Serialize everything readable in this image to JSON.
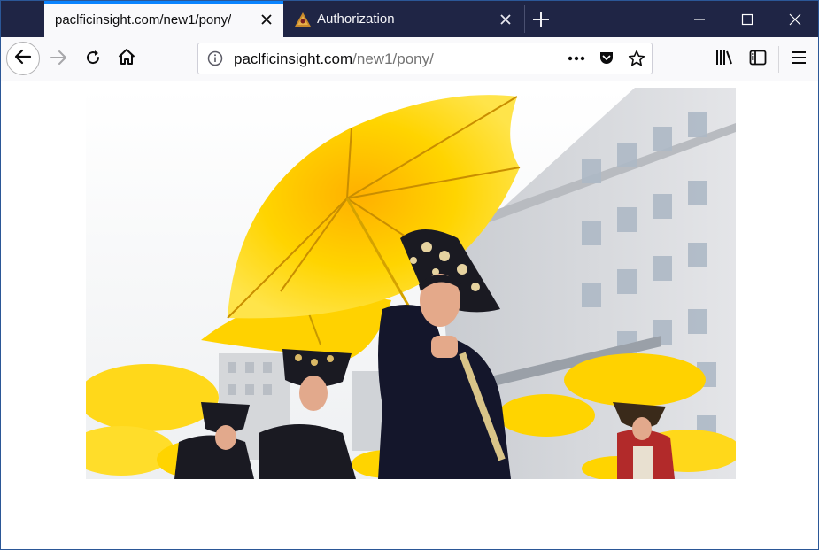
{
  "tabs": [
    {
      "label": "paclficinsight.com/new1/pony/",
      "active": true
    },
    {
      "label": "Authorization",
      "active": false,
      "favicon": "shield-warning-icon"
    }
  ],
  "address_bar": {
    "host": "paclficinsight.com",
    "path": "/new1/pony/"
  },
  "icons": {
    "back": "arrow-left-icon",
    "forward": "arrow-right-icon",
    "reload": "reload-icon",
    "home": "home-icon",
    "site_info": "info-icon",
    "page_actions": "more-horizontal-icon",
    "pocket": "pocket-icon",
    "bookmark": "star-icon",
    "library": "library-icon",
    "sidebar": "sidebar-icon",
    "menu": "hamburger-menu-icon"
  },
  "colors": {
    "tabbar_background": "#1f2545",
    "active_tab_accent": "#0a84ff",
    "umbrella_yellow": "#ffd400"
  }
}
